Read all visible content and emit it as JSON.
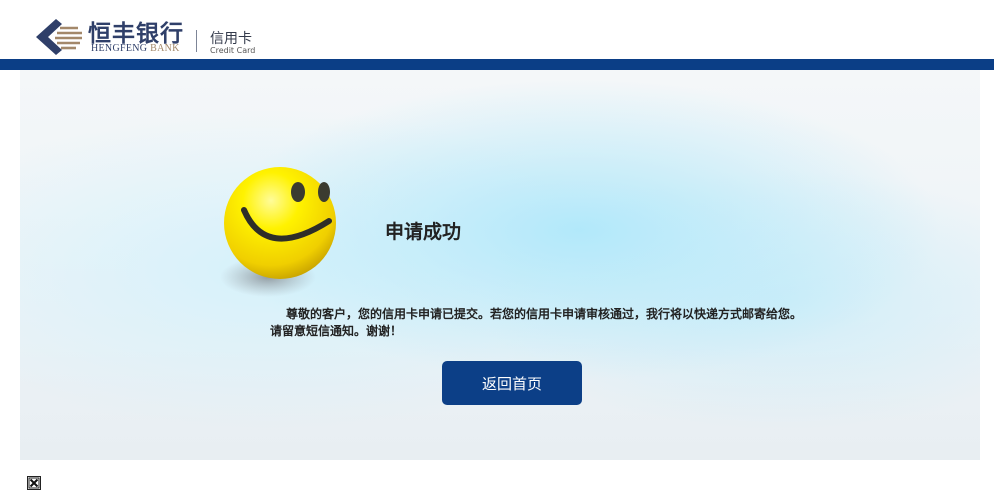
{
  "header": {
    "brand_cn": "恒丰银行",
    "brand_en_prefix": "HENGFENG",
    "brand_en_suffix": "BANK",
    "product_cn": "信用卡",
    "product_en": "Credit Card",
    "logo_icon": "hengfeng-diamond-logo-icon",
    "bar_color": "#0b3e86"
  },
  "result": {
    "icon": "smiley-face-icon",
    "title": "申请成功",
    "message_line1": "尊敬的客户，您的信用卡申请已提交。若您的信用卡申请审核通过，我行将以快递方式邮寄给您。",
    "message_line2": "请留意短信通知。谢谢！"
  },
  "actions": {
    "home_label": "返回首页",
    "button_color": "#0c3f87"
  },
  "footer": {
    "icon": "broken-image-icon"
  }
}
